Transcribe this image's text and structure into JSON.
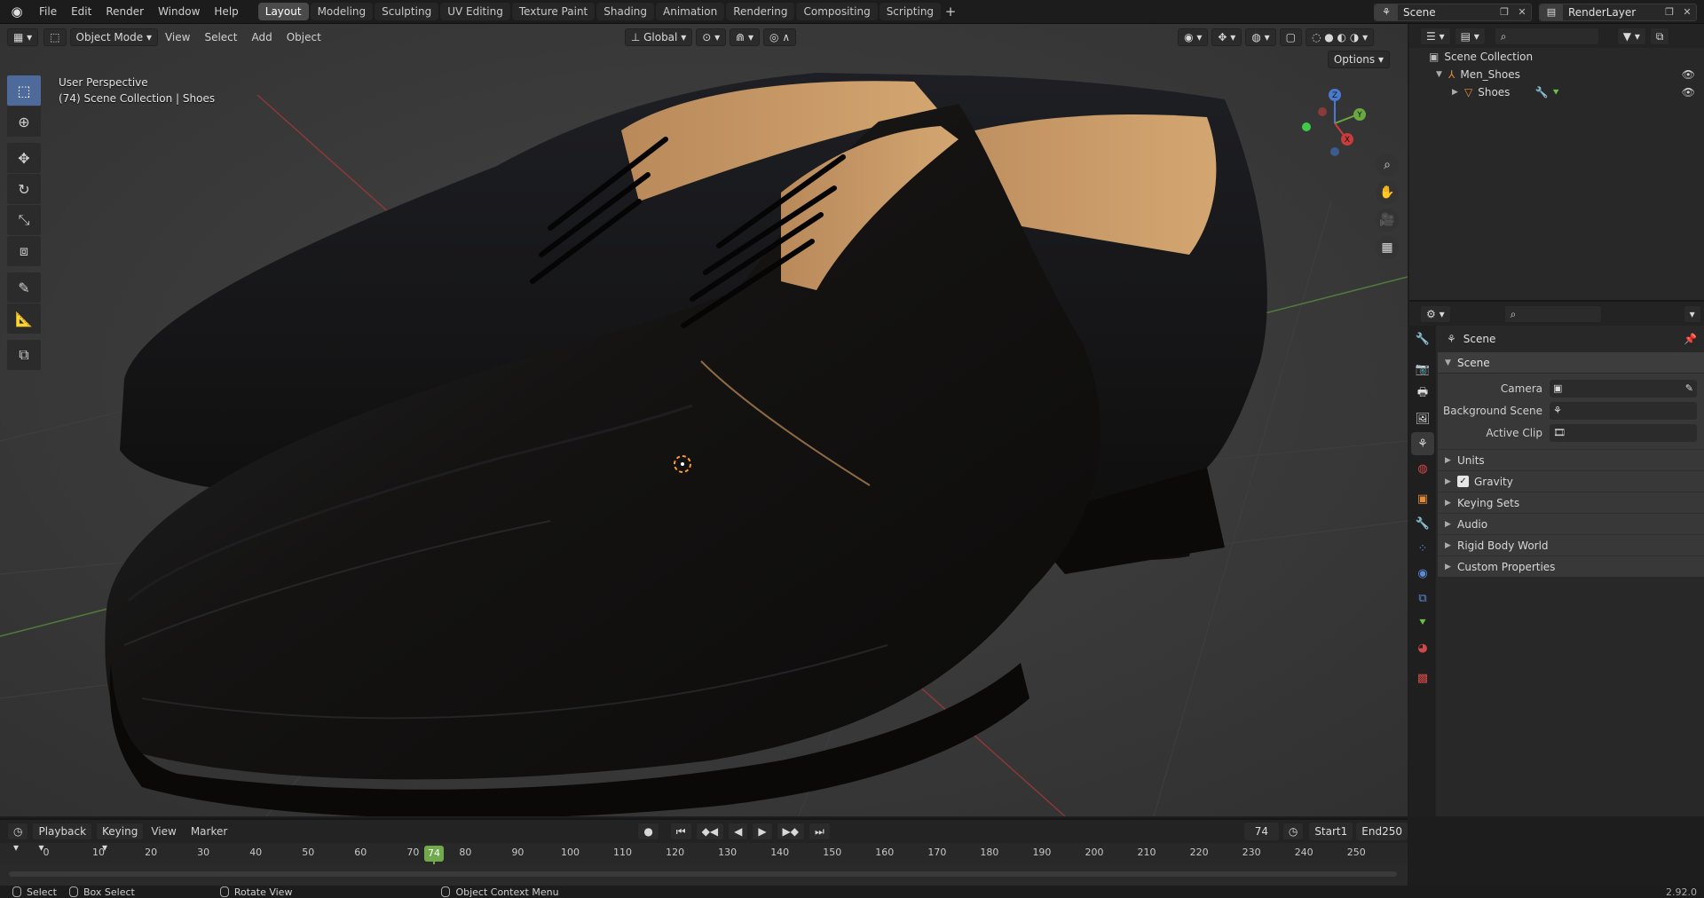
{
  "topbar": {
    "menus": [
      "File",
      "Edit",
      "Render",
      "Window",
      "Help"
    ],
    "workspaces": [
      "Layout",
      "Modeling",
      "Sculpting",
      "UV Editing",
      "Texture Paint",
      "Shading",
      "Animation",
      "Rendering",
      "Compositing",
      "Scripting"
    ],
    "active_workspace": "Layout",
    "add_tab": "+",
    "scene_name": "Scene",
    "view_layer": "RenderLayer"
  },
  "viewport": {
    "mode": "Object Mode",
    "menus": [
      "View",
      "Select",
      "Add",
      "Object"
    ],
    "transform_orientation": "Global",
    "options_label": "Options",
    "perspective_label": "User Perspective",
    "collection_label": "(74) Scene Collection | Shoes",
    "gizmo_axes": {
      "x": "X",
      "y": "Y",
      "z": "Z"
    },
    "colors": {
      "background": "#393939",
      "shoe": "#15120f",
      "shoe_lining": "#c79a62",
      "x_axis": "#8a3a3a",
      "y_axis": "#4f8a3a"
    }
  },
  "outliner": {
    "root": "Scene Collection",
    "collection": "Men_Shoes",
    "object": "Shoes"
  },
  "properties": {
    "context": "Scene",
    "panel_title": "Scene",
    "fields": [
      {
        "label": "Camera",
        "value": ""
      },
      {
        "label": "Background Scene",
        "value": ""
      },
      {
        "label": "Active Clip",
        "value": ""
      }
    ],
    "subpanels": [
      "Units",
      "Gravity",
      "Keying Sets",
      "Audio",
      "Rigid Body World",
      "Custom Properties"
    ],
    "gravity_checked": true
  },
  "timeline": {
    "menus": [
      "Playback",
      "Keying",
      "View",
      "Marker"
    ],
    "current_frame": "74",
    "start_label": "Start",
    "start": "1",
    "end_label": "End",
    "end": "250",
    "ticks": [
      "0",
      "10",
      "20",
      "30",
      "40",
      "50",
      "60",
      "70",
      "80",
      "90",
      "100",
      "110",
      "120",
      "130",
      "140",
      "150",
      "160",
      "170",
      "180",
      "190",
      "200",
      "210",
      "220",
      "230",
      "240",
      "250"
    ]
  },
  "statusbar": {
    "select": "Select",
    "box_select": "Box Select",
    "rotate": "Rotate View",
    "context_menu": "Object Context Menu",
    "version": "2.92.0"
  }
}
